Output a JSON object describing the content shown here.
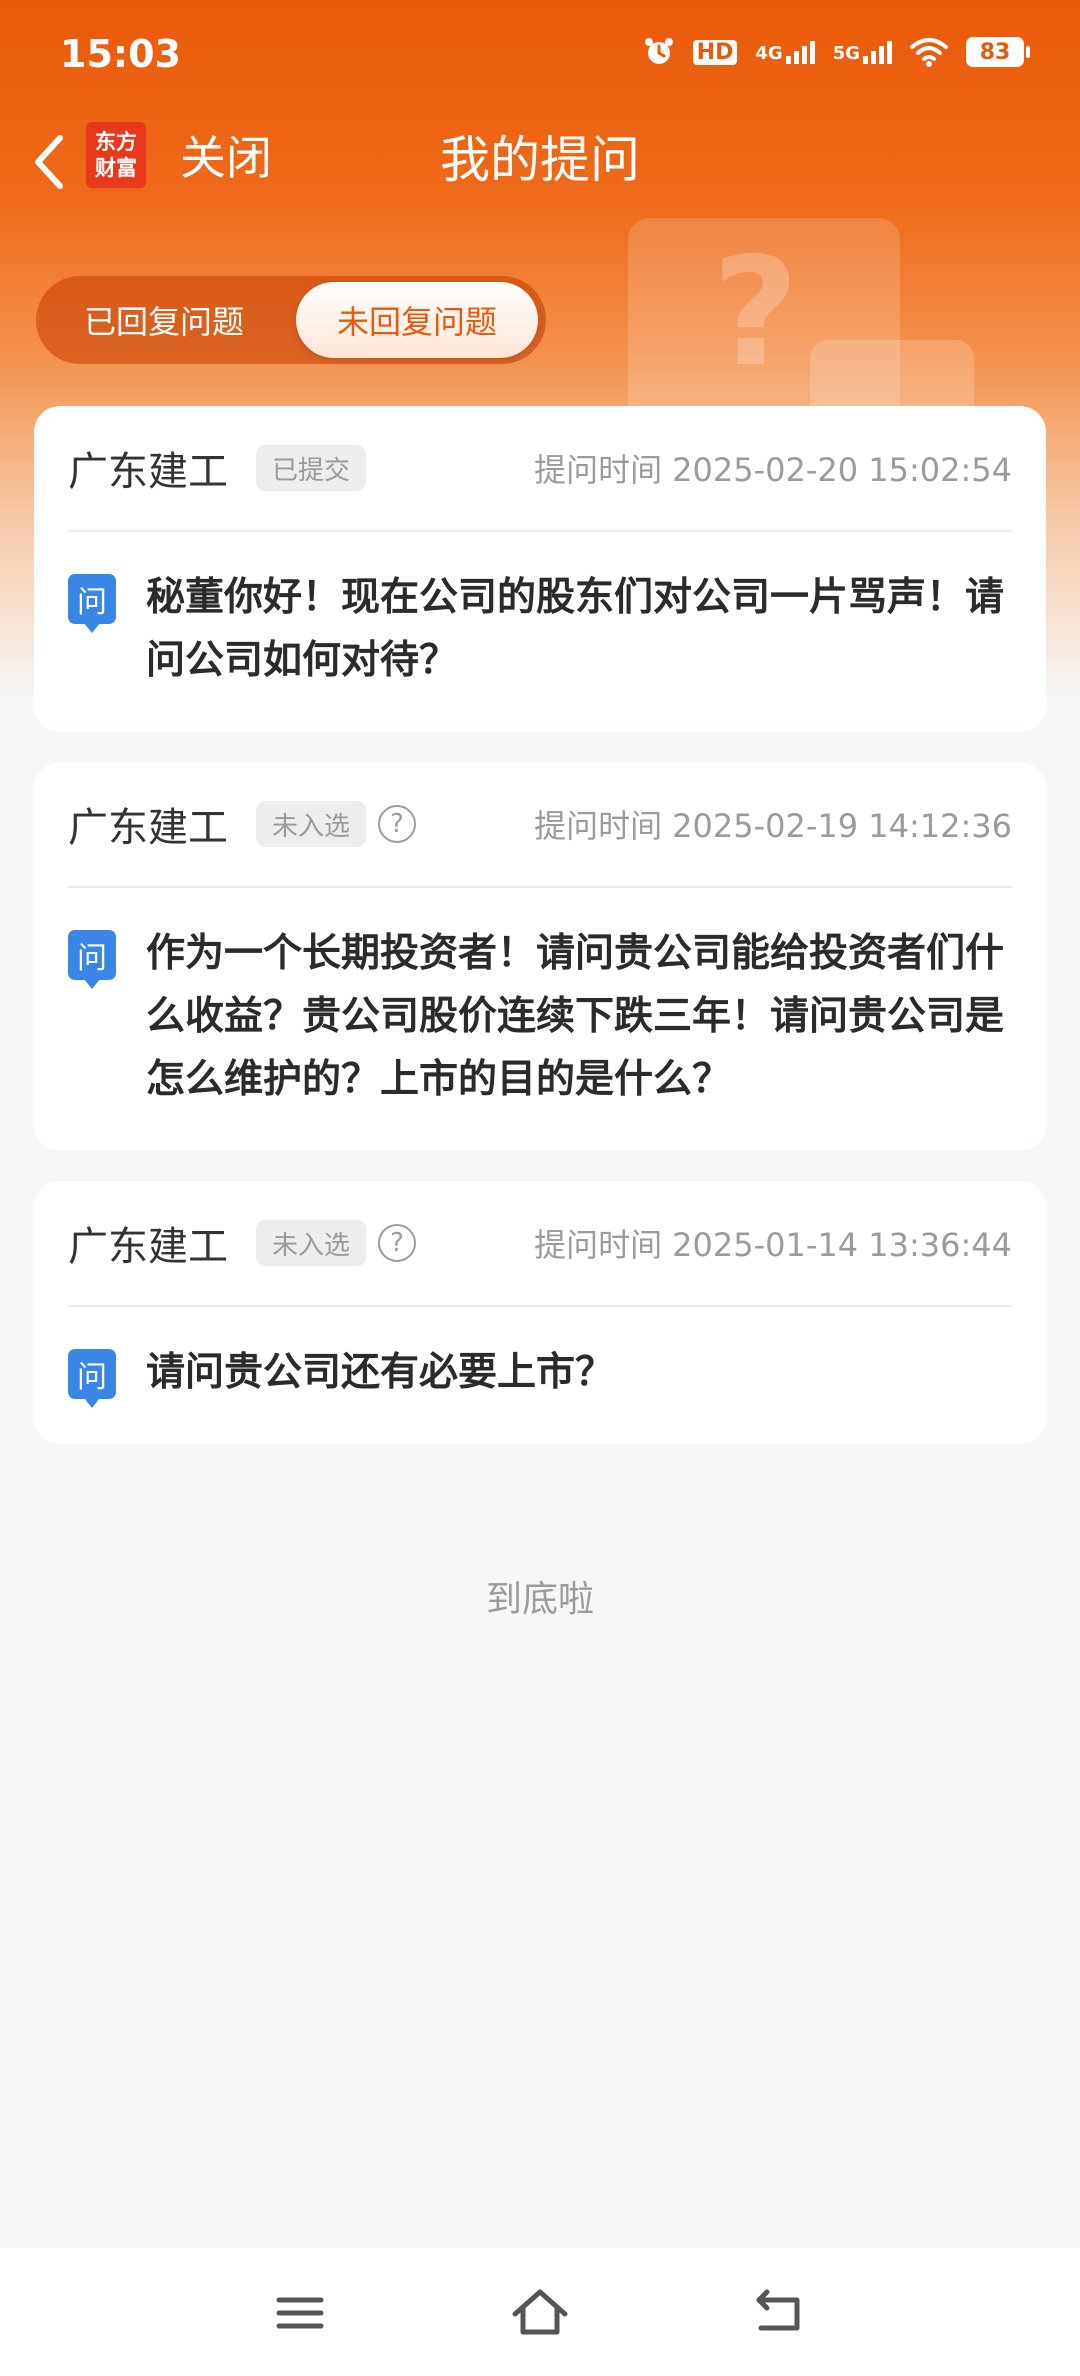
{
  "status_bar": {
    "time": "15:03",
    "hd_label": "HD",
    "net1": "4G",
    "net2": "5G",
    "battery": "83"
  },
  "nav": {
    "logo_line1": "东方",
    "logo_line2": "财富",
    "close_label": "关闭",
    "title": "我的提问"
  },
  "tabs": [
    {
      "label": "已回复问题",
      "active": false
    },
    {
      "label": "未回复问题",
      "active": true
    }
  ],
  "questions": [
    {
      "company": "广东建工",
      "status": "已提交",
      "has_help": false,
      "time_label": "提问时间",
      "time": "2025-02-20 15:02:54",
      "icon_label": "问",
      "text": "秘董你好！现在公司的股东们对公司一片骂声！请问公司如何对待？"
    },
    {
      "company": "广东建工",
      "status": "未入选",
      "has_help": true,
      "time_label": "提问时间",
      "time": "2025-02-19 14:12:36",
      "icon_label": "问",
      "text": "作为一个长期投资者！请问贵公司能给投资者们什么收益？贵公司股价连续下跌三年！请问贵公司是怎么维护的？上市的目的是什么？"
    },
    {
      "company": "广东建工",
      "status": "未入选",
      "has_help": true,
      "time_label": "提问时间",
      "time": "2025-01-14 13:36:44",
      "icon_label": "问",
      "text": "请问贵公司还有必要上市？"
    }
  ],
  "help_glyph": "?",
  "end_text": "到底啦",
  "hero_glyph": "?",
  "colors": {
    "brand_orange": "#ea5a0b",
    "question_icon_blue": "#3a86e6"
  }
}
